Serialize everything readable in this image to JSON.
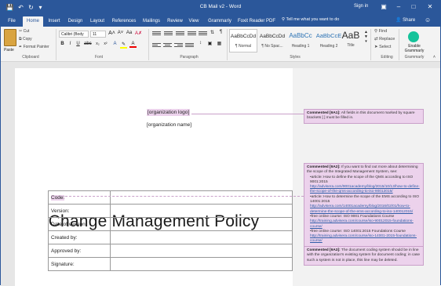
{
  "titlebar": {
    "title": "CB Mail v2  -  Word",
    "signin": "Sign in"
  },
  "tabs": [
    "File",
    "Home",
    "Insert",
    "Design",
    "Layout",
    "References",
    "Mailings",
    "Review",
    "View",
    "Grammarly",
    "Foxit Reader PDF"
  ],
  "tell_me": "Tell me what you want to do",
  "share": "Share",
  "ribbon": {
    "clipboard": {
      "paste": "Paste",
      "cut": "Cut",
      "copy": "Copy",
      "format_painter": "Format Painter",
      "label": "Clipboard"
    },
    "font": {
      "font_name": "Calibri (Body",
      "font_size": "11",
      "label": "Font"
    },
    "paragraph": {
      "label": "Paragraph"
    },
    "styles": {
      "items": [
        {
          "preview": "AaBbCcDd",
          "name": "¶ Normal"
        },
        {
          "preview": "AaBbCcDd",
          "name": "¶ No Spac..."
        },
        {
          "preview": "AaBbCc",
          "name": "Heading 1"
        },
        {
          "preview": "AaBbCcE",
          "name": "Heading 2"
        },
        {
          "preview": "AaB",
          "name": "Title"
        }
      ],
      "label": "Styles"
    },
    "editing": {
      "find": "Find",
      "replace": "Replace",
      "select": "Select",
      "label": "Editing"
    },
    "grammarly": {
      "enable": "Enable Grammarly",
      "label": "Grammarly"
    }
  },
  "document": {
    "logo_placeholder": "[organization logo]",
    "org_name": "[organization name]",
    "title": "Change Management Policy",
    "table": [
      {
        "label": "Code:",
        "value": ""
      },
      {
        "label": "Version:",
        "value": ""
      },
      {
        "label": "Date of version:",
        "value": ""
      },
      {
        "label": "Created by:",
        "value": ""
      },
      {
        "label": "Approved by:",
        "value": ""
      },
      {
        "label": "Signature:",
        "value": ""
      }
    ]
  },
  "comments": [
    {
      "id": "Commented [9A1]:",
      "text": "All fields in this document marked by square brackets [ ] must be filled in."
    },
    {
      "id": "Commented [9A2]:",
      "text": "If you want to find out more about determining the scope of the Integrated Management System, see:",
      "items": [
        {
          "text": "article: How to define the scope of the QMS according to ISO 9001:2015",
          "link": "http://advisera.com/9001academy/blog/2015/10/13/how-to-define-the-scope-of-the-qms-according-to-iso-90012015/"
        },
        {
          "text": "article: How to determine the scope of the EMS according to ISO 14001:2015",
          "link": "http://advisera.com/14001academy/blog/2016/02/01/how-to-determine-the-scope-of-the-ems-according-to-iso-140012015/"
        },
        {
          "text": "free online course: ISO 9001 Foundations Course",
          "link": "http://training.advisera.com/course/iso-90012015-foundations-course/"
        },
        {
          "text": "free online course: ISO 14001:2015 Foundations Course",
          "link": "http://training.advisera.com/course/iso-14001-2015-foundations-course/"
        }
      ]
    },
    {
      "id": "Commented [9A3]:",
      "text": "The document coding system should be in line with the organization's existing system for document coding; in case such a system is not in place, this line may be deleted."
    }
  ],
  "colors": {
    "brand": "#2b579a",
    "comment_bg": "#ecd2ec",
    "comment_border": "#c9a0c9"
  }
}
